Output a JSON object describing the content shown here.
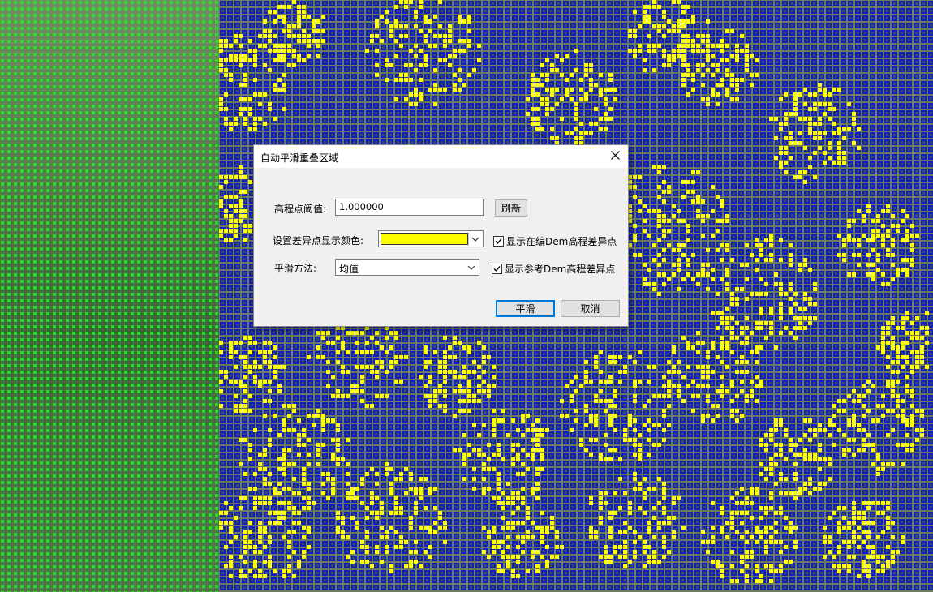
{
  "dialog": {
    "title": "自动平滑重叠区域",
    "elevation_threshold": {
      "label": "高程点阈值:",
      "value": "1.000000"
    },
    "refresh_label": "刷新",
    "diff_color": {
      "label": "设置差异点显示颜色:",
      "color": "#ffff00"
    },
    "smoothing_method": {
      "label": "平滑方法:",
      "value": "均值"
    },
    "show_editing_dem": {
      "label": "显示在编Dem高程差异点",
      "checked": true
    },
    "show_reference_dem": {
      "label": "显示参考Dem高程差异点",
      "checked": true
    },
    "smooth_label": "平滑",
    "cancel_label": "取消"
  },
  "colors": {
    "left_dem_points": "#22ee22",
    "grid_points": "#1020c0",
    "diff_points": "#ffff00"
  },
  "icons": [
    "close-icon",
    "chevron-down-icon",
    "check-icon"
  ]
}
